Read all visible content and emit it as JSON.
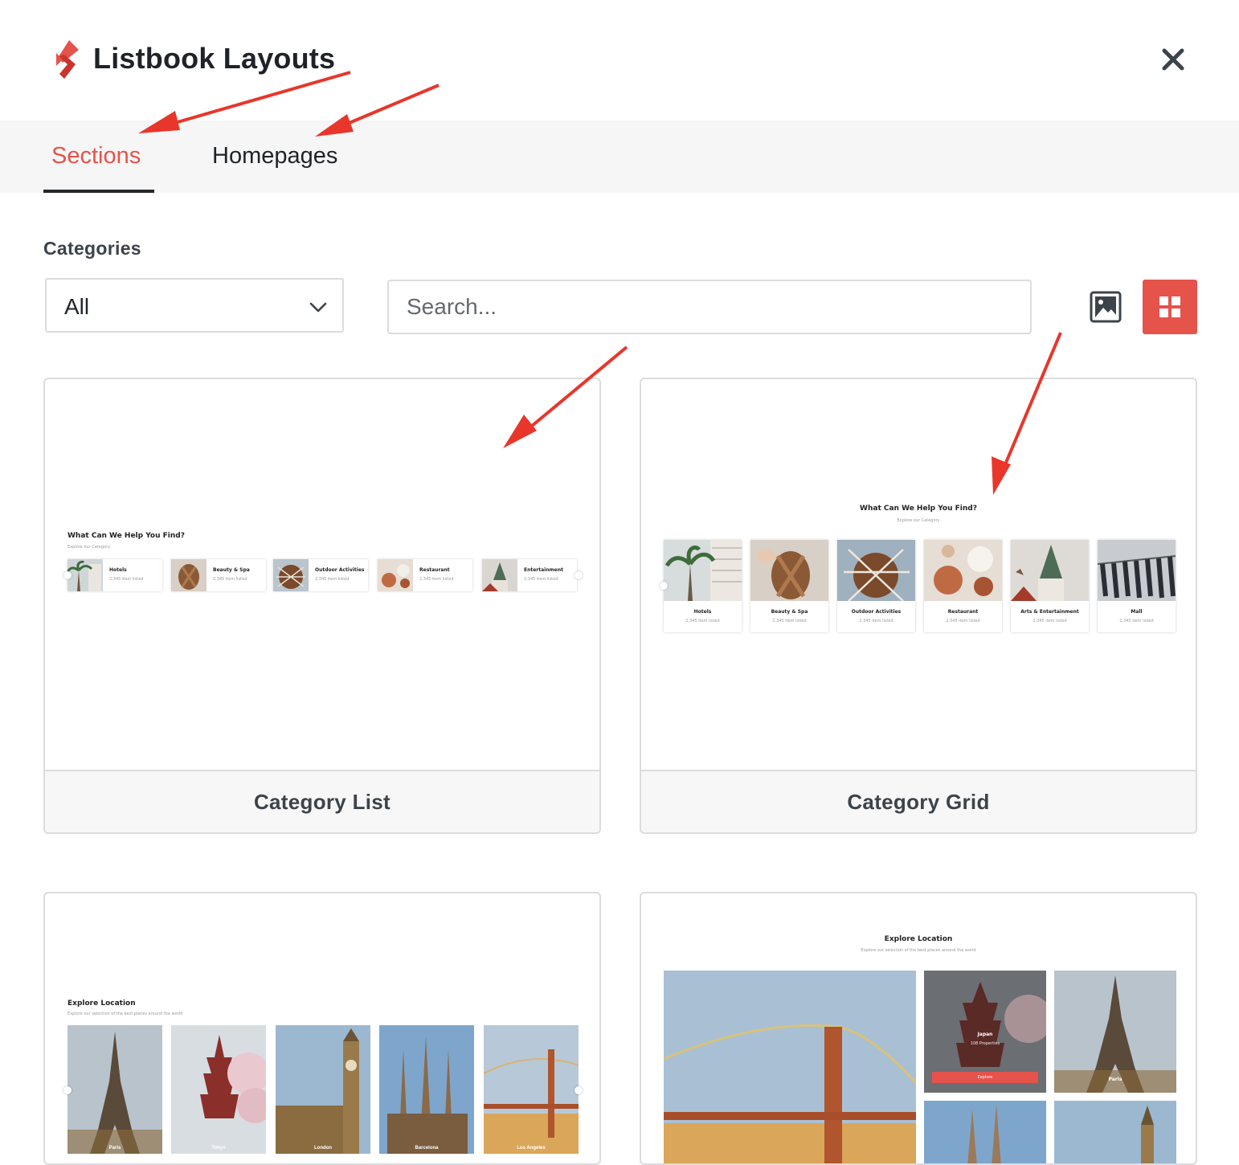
{
  "header": {
    "title": "Listbook Layouts"
  },
  "tabs": [
    {
      "label": "Sections",
      "active": true
    },
    {
      "label": "Homepages",
      "active": false
    }
  ],
  "filters": {
    "categories_label": "Categories",
    "category_selected": "All",
    "search_placeholder": "Search..."
  },
  "colors": {
    "accent": "#e5534b",
    "tab_underline": "#23282d",
    "annotation_arrow": "#e8362b"
  },
  "icons": {
    "logo": "listbook-logo-icon",
    "close": "close-icon",
    "dropdown": "chevron-down-icon",
    "image_view": "image-icon",
    "grid_view": "grid-icon"
  },
  "cards": [
    {
      "name": "Category List",
      "preview": {
        "title": "What Can We Help You Find?",
        "subtitle": "Explore our Category",
        "items": [
          {
            "name": "Hotels",
            "count": "2,345 item listed"
          },
          {
            "name": "Beauty & Spa",
            "count": "2,345 item listed"
          },
          {
            "name": "Outdoor Activities",
            "count": "2,345 item listed"
          },
          {
            "name": "Restaurant",
            "count": "2,345 item listed"
          },
          {
            "name": "Entertainment",
            "count": "2,345 item listed"
          }
        ]
      }
    },
    {
      "name": "Category Grid",
      "preview": {
        "title": "What Can We Help You Find?",
        "subtitle": "Explore our Category",
        "items": [
          {
            "name": "Hotels",
            "count": "2,345 item listed"
          },
          {
            "name": "Beauty & Spa",
            "count": "2,345 item listed"
          },
          {
            "name": "Outdoor Activities",
            "count": "2,345 item listed"
          },
          {
            "name": "Restaurant",
            "count": "2,345 item listed"
          },
          {
            "name": "Arts & Entertainment",
            "count": "2,345 item listed"
          },
          {
            "name": "Mall",
            "count": "2,345 item listed"
          }
        ]
      }
    },
    {
      "preview": {
        "title": "Explore Location",
        "subtitle": "Explore our selection of the best places around the world",
        "items": [
          "Paris",
          "Tokyo",
          "London",
          "Barcelona",
          "Los Angeles"
        ]
      }
    },
    {
      "preview": {
        "title": "Explore Location",
        "subtitle": "Explore our selection of the best places around the world",
        "featured": {
          "name": "Japan",
          "count": "108 Properties",
          "button": "Explore"
        },
        "side_label": "Paris"
      }
    }
  ]
}
